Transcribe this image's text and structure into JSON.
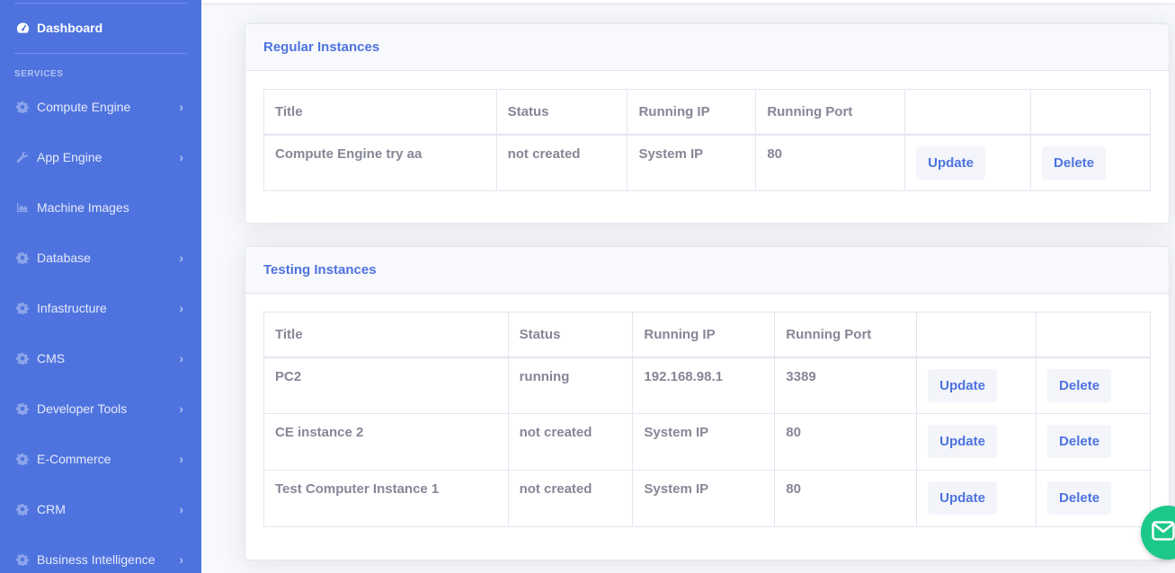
{
  "sidebar": {
    "dashboard": {
      "label": "Dashboard",
      "icon": "tachometer-icon"
    },
    "heading": "SERVICES",
    "items": [
      {
        "label": "Compute Engine",
        "icon": "gear-icon",
        "chevron": true
      },
      {
        "label": "App Engine",
        "icon": "wrench-icon",
        "chevron": true
      },
      {
        "label": "Machine Images",
        "icon": "chart-area-icon",
        "chevron": false
      },
      {
        "label": "Database",
        "icon": "gear-icon",
        "chevron": true
      },
      {
        "label": "Infastructure",
        "icon": "gear-icon",
        "chevron": true
      },
      {
        "label": "CMS",
        "icon": "gear-icon",
        "chevron": true
      },
      {
        "label": "Developer Tools",
        "icon": "gear-icon",
        "chevron": true
      },
      {
        "label": "E-Commerce",
        "icon": "gear-icon",
        "chevron": true
      },
      {
        "label": "CRM",
        "icon": "gear-icon",
        "chevron": true
      },
      {
        "label": "Business Intelligence",
        "icon": "gear-icon",
        "chevron": true
      }
    ],
    "chevron_glyph": "›"
  },
  "regular": {
    "title": "Regular Instances",
    "headers": [
      "Title",
      "Status",
      "Running IP",
      "Running Port",
      "",
      ""
    ],
    "rows": [
      {
        "title": "Compute Engine try aa",
        "status": "not created",
        "ip": "System IP",
        "port": "80",
        "update": "Update",
        "delete": "Delete"
      }
    ]
  },
  "testing": {
    "title": "Testing Instances",
    "headers": [
      "Title",
      "Status",
      "Running IP",
      "Running Port",
      "",
      ""
    ],
    "rows": [
      {
        "title": "PC2",
        "status": "running",
        "ip": "192.168.98.1",
        "port": "3389",
        "update": "Update",
        "delete": "Delete"
      },
      {
        "title": "CE instance 2",
        "status": "not created",
        "ip": "System IP",
        "port": "80",
        "update": "Update",
        "delete": "Delete"
      },
      {
        "title": "Test Computer Instance 1",
        "status": "not created",
        "ip": "System IP",
        "port": "80",
        "update": "Update",
        "delete": "Delete"
      }
    ]
  },
  "colors": {
    "primary": "#4e73df",
    "success": "#1cc88a",
    "text": "#858796"
  },
  "fab": {
    "icon": "envelope-icon"
  }
}
